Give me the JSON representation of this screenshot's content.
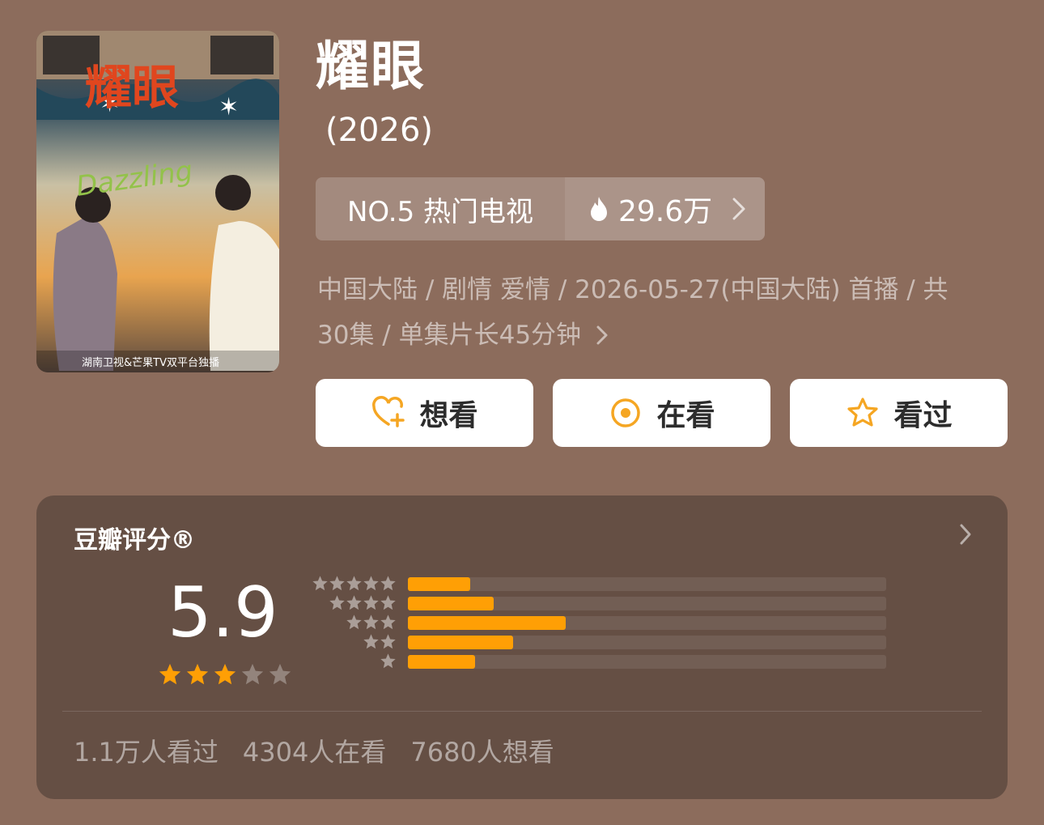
{
  "show": {
    "title": "耀眼",
    "year": "(2026)",
    "rank_label": "NO.5 热门电视",
    "heat": "29.6万",
    "meta_line1": "中国大陆 / 剧情 爱情 / 2026-05-27(中国大陆) 首播 / 共",
    "meta_line2": "30集 / 单集片长45分钟"
  },
  "poster": {
    "title_art": "耀眼",
    "english": "Dazzling",
    "footer": "湖南卫视&芒果TV双平台独播"
  },
  "actions": {
    "want": "想看",
    "watching": "在看",
    "watched": "看过"
  },
  "rating": {
    "title": "豆瓣评分®",
    "score": "5.9",
    "stars_filled": 3,
    "stars_total": 5,
    "distribution": [
      {
        "stars": 5,
        "fraction": 0.13
      },
      {
        "stars": 4,
        "fraction": 0.18
      },
      {
        "stars": 3,
        "fraction": 0.33
      },
      {
        "stars": 2,
        "fraction": 0.22
      },
      {
        "stars": 1,
        "fraction": 0.14
      }
    ],
    "counts": [
      "1.1万人看过",
      "4304人在看",
      "7680人想看"
    ]
  },
  "colors": {
    "background": "#8c6c5c",
    "card": "#654f44",
    "accent": "#ff9f05",
    "button_icon": "#f5a623"
  }
}
